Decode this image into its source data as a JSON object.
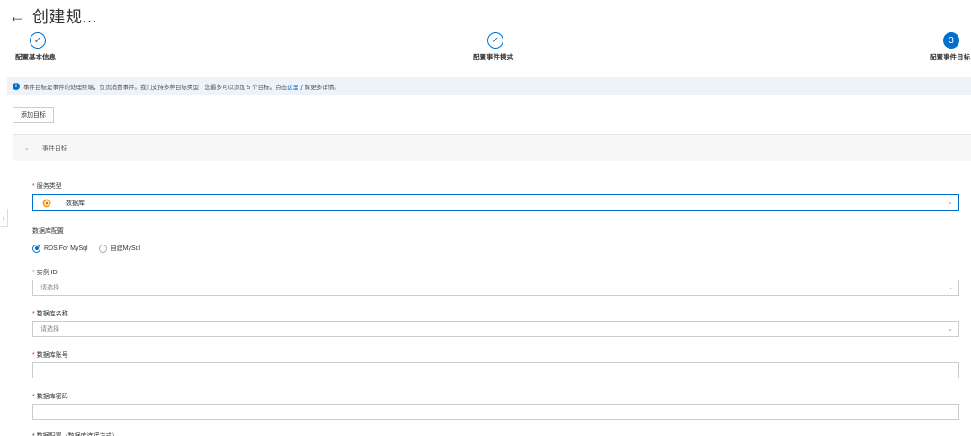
{
  "header": {
    "back_icon": "arrow-left-icon",
    "title": "创建规..."
  },
  "steps": [
    {
      "index": "✓",
      "label": "配置基本信息",
      "state": "done"
    },
    {
      "index": "✓",
      "label": "配置事件模式",
      "state": "done"
    },
    {
      "index": "3",
      "label": "配置事件目标",
      "state": "active"
    }
  ],
  "info": {
    "icon": "info-icon",
    "text_before": "事件目标是事件的处理终端，负责消费事件。我们支持多种目标类型，您最多可以添加 5 个目标。点击",
    "link": "这里",
    "text_after": "了解更多详情。"
  },
  "add_button": "添加目标",
  "panel": {
    "title": "事件目标",
    "service_type": {
      "label": "服务类型",
      "value": "数据库",
      "icon": "database-icon"
    },
    "db_config_label": "数据库配置",
    "db_options": [
      "RDS For MySql",
      "自建MySql"
    ],
    "instance_id": {
      "label": "实例 ID",
      "placeholder": "请选择"
    },
    "db_name": {
      "label": "数据库名称",
      "placeholder": "请选择"
    },
    "db_account": {
      "label": "数据库账号"
    },
    "db_password": {
      "label": "数据库密码"
    },
    "cut_label": "* 数据配置（数据库连接方式）"
  },
  "colors": {
    "accent": "#0070cc",
    "required": "#e02020"
  }
}
